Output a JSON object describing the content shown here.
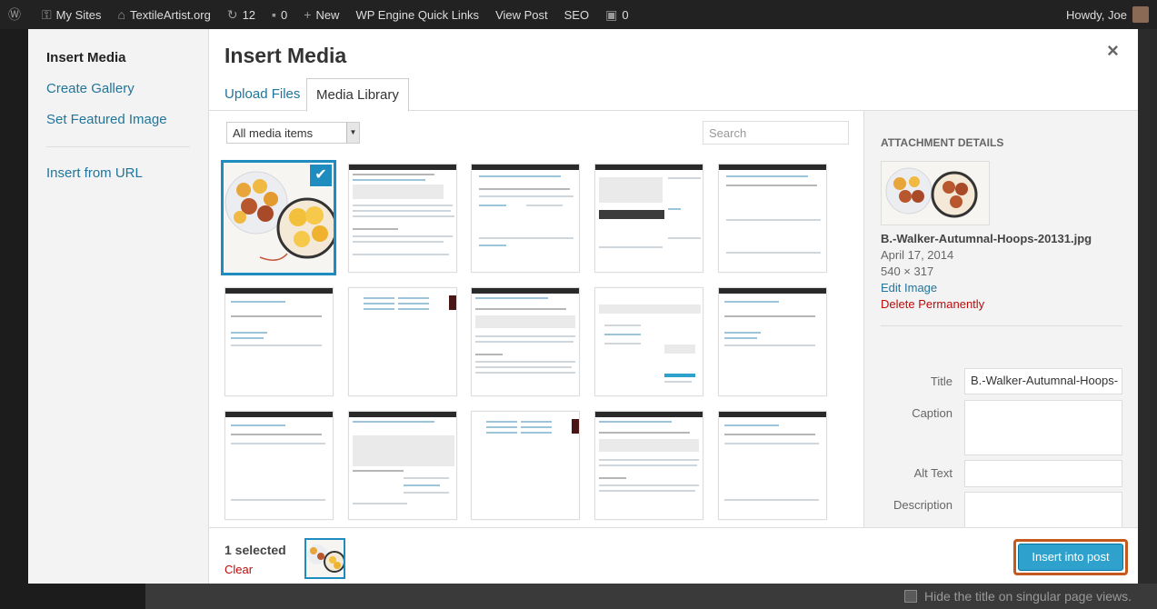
{
  "admin_bar": {
    "my_sites": "My Sites",
    "site_name": "TextileArtist.org",
    "updates": "12",
    "comments": "0",
    "new": "New",
    "quick_links": "WP Engine Quick Links",
    "view_post": "View Post",
    "seo": "SEO",
    "seo_count": "0",
    "howdy": "Howdy, Joe"
  },
  "menu": {
    "insert_media": "Insert Media",
    "create_gallery": "Create Gallery",
    "set_featured": "Set Featured Image",
    "insert_url": "Insert from URL"
  },
  "frame": {
    "title": "Insert Media",
    "close": "×",
    "tabs": [
      "Upload Files",
      "Media Library"
    ]
  },
  "filter": {
    "selected": "All media items",
    "search_placeholder": "Search"
  },
  "attachment": {
    "heading": "ATTACHMENT DETAILS",
    "filename": "B.-Walker-Autumnal-Hoops-20131.jpg",
    "date": "April 17, 2014",
    "dimensions": "540 × 317",
    "edit": "Edit Image",
    "delete": "Delete Permanently",
    "fields": {
      "title_label": "Title",
      "title_value": "B.-Walker-Autumnal-Hoops-",
      "caption_label": "Caption",
      "alt_label": "Alt Text",
      "description_label": "Description"
    }
  },
  "toolbar": {
    "selected": "1 selected",
    "clear": "Clear",
    "insert": "Insert into post"
  },
  "background": {
    "hide_title": "Hide the title on singular page views."
  }
}
